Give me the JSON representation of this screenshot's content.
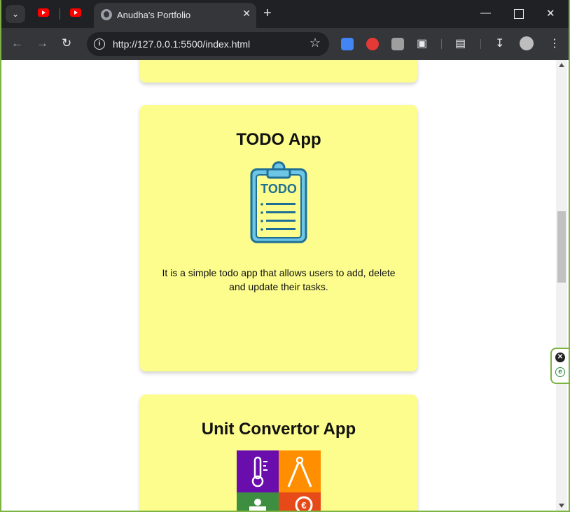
{
  "browser": {
    "tab_title": "Anudha's Portfolio",
    "url": "http://127.0.0.1:5500/index.html",
    "icons": [
      "tab-search-icon",
      "youtube-icon",
      "globe-icon",
      "close-icon",
      "plus-icon",
      "minimize-icon",
      "maximize-icon",
      "back-icon",
      "forward-icon",
      "reload-icon",
      "info-icon",
      "star-icon",
      "translate-icon",
      "adblock-icon",
      "extension-icon",
      "puzzle-icon",
      "reading-list-icon",
      "download-icon",
      "profile-icon",
      "menu-icon"
    ]
  },
  "projects": [
    {
      "title": "TODO App",
      "image_label": "TODO",
      "description": "It is a simple todo app that allows users to add, delete and update their tasks."
    },
    {
      "title": "Unit Convertor App",
      "tiles": [
        {
          "icon": "thermometer-icon",
          "color": "#6a0dad"
        },
        {
          "icon": "compass-icon",
          "color": "#ff8f00"
        },
        {
          "icon": "weight-icon",
          "color": "#3e8e41"
        },
        {
          "icon": "currency-icon",
          "color": "#e64a19"
        }
      ]
    }
  ],
  "colors": {
    "card_bg": "#fdfd8d",
    "page_bg": "#ffffff",
    "chrome_dark": "#202124",
    "chrome_mid": "#35363a",
    "window_border": "#7cb342"
  }
}
